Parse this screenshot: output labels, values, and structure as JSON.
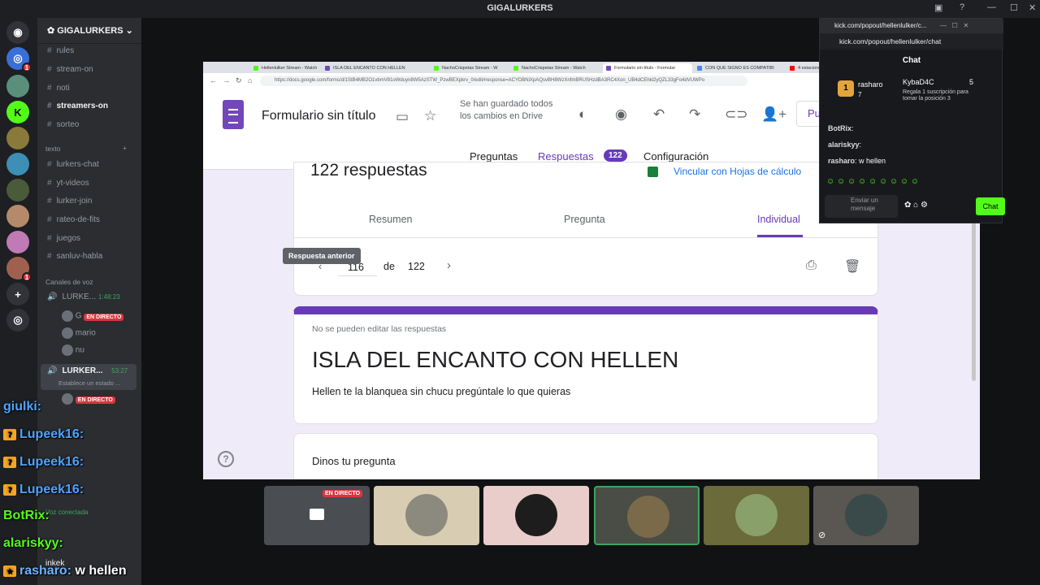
{
  "window": {
    "title": "GIGALURKERS"
  },
  "discord": {
    "guild": "GIGALURKERS",
    "channels": [
      "rules",
      "stream-on",
      "noti",
      "streamers-on",
      "sorteo"
    ],
    "category_text": "texto",
    "text_channels": [
      "lurkers-chat",
      "yt-videos",
      "lurker-join",
      "rateo-de-fits",
      "juegos",
      "sanluv-habla"
    ],
    "category_voice": "Canales de voz",
    "voice1": {
      "name": "LURKE...",
      "time": "1:48:23",
      "members": [
        "G",
        "mario",
        "nu"
      ]
    },
    "voice2": {
      "name": "LURKER...",
      "time": "53:27",
      "status": "Establece un estado ..."
    },
    "live_label": "EN DIRECTO",
    "voice_connected": "Voz conectada",
    "user": "inkek"
  },
  "browser": {
    "tabs": [
      "Hellenlulker Stream - Watch",
      "ISLA DEL ENCANTO CON HELLEN",
      "NachoCrispetas Stream - W",
      "NachoCrispetas Stream - Watch",
      "Formulario sin título - Formular",
      "CON QUE SIGNO ES COMPATIBI",
      "4 estaciones"
    ],
    "url": "https://docs.google.com/forms/d/1StB4MB2O1vbmV81oWduyn8W5AzSTW_PzwBEXpkrv_0/edit#response=ACYDBNiXpAQsvBH8WzXnfmBRUSHzdBA3RC4Xon_UB4dCEhkl2yQZL33gFo4dVUWPo"
  },
  "forms": {
    "title": "Formulario sin título",
    "saved": "Se han guardado todos los cambios en Drive",
    "publish": "Pu",
    "tabs": [
      "Preguntas",
      "Respuestas",
      "Configuración"
    ],
    "response_badge": "122",
    "responses_heading": "122 respuestas",
    "link_sheets": "Vincular con Hojas de cálculo",
    "summary_tabs": [
      "Resumen",
      "Pregunta",
      "Individual"
    ],
    "pager": {
      "current": "116",
      "of": "de",
      "total": "122"
    },
    "tooltip": "Respuesta anterior",
    "no_edit": "No se pueden editar las respuestas",
    "form_title": "ISLA DEL ENCANTO CON HELLEN",
    "form_desc": "Hellen te la blanquea sin chucu pregúntale lo que quieras",
    "question": "Dinos tu pregunta"
  },
  "kick": {
    "title": "kick.com/popout/hellenlulker/c...",
    "url": "kick.com/popout/hellenlulker/chat",
    "header": "Chat",
    "sub_user": "rasharo",
    "sub_count": "7",
    "gifter": "KybaD4C",
    "gift_count": "5",
    "gift_text": "Regala 1 suscripción para tomar la posición 3",
    "messages": [
      {
        "user": "BotRix",
        "text": ":"
      },
      {
        "user": "alariskyy",
        "text": ":"
      },
      {
        "user": "rasharo",
        "text": ": w hellen"
      }
    ],
    "input_placeholder": "Enviar un mensaje",
    "chat_button": "Chat"
  },
  "call": {
    "live_label": "EN DIRECTO"
  },
  "overlay": [
    {
      "user": "giulki:",
      "text": ""
    },
    {
      "user": "Lupeek16:",
      "text": ""
    },
    {
      "user": "Lupeek16:",
      "text": ""
    },
    {
      "user": "Lupeek16:",
      "text": ""
    },
    {
      "user": "BotRix:",
      "text": ""
    },
    {
      "user": "alariskyy:",
      "text": ""
    },
    {
      "user": "rasharo:",
      "text": " w hellen"
    }
  ]
}
